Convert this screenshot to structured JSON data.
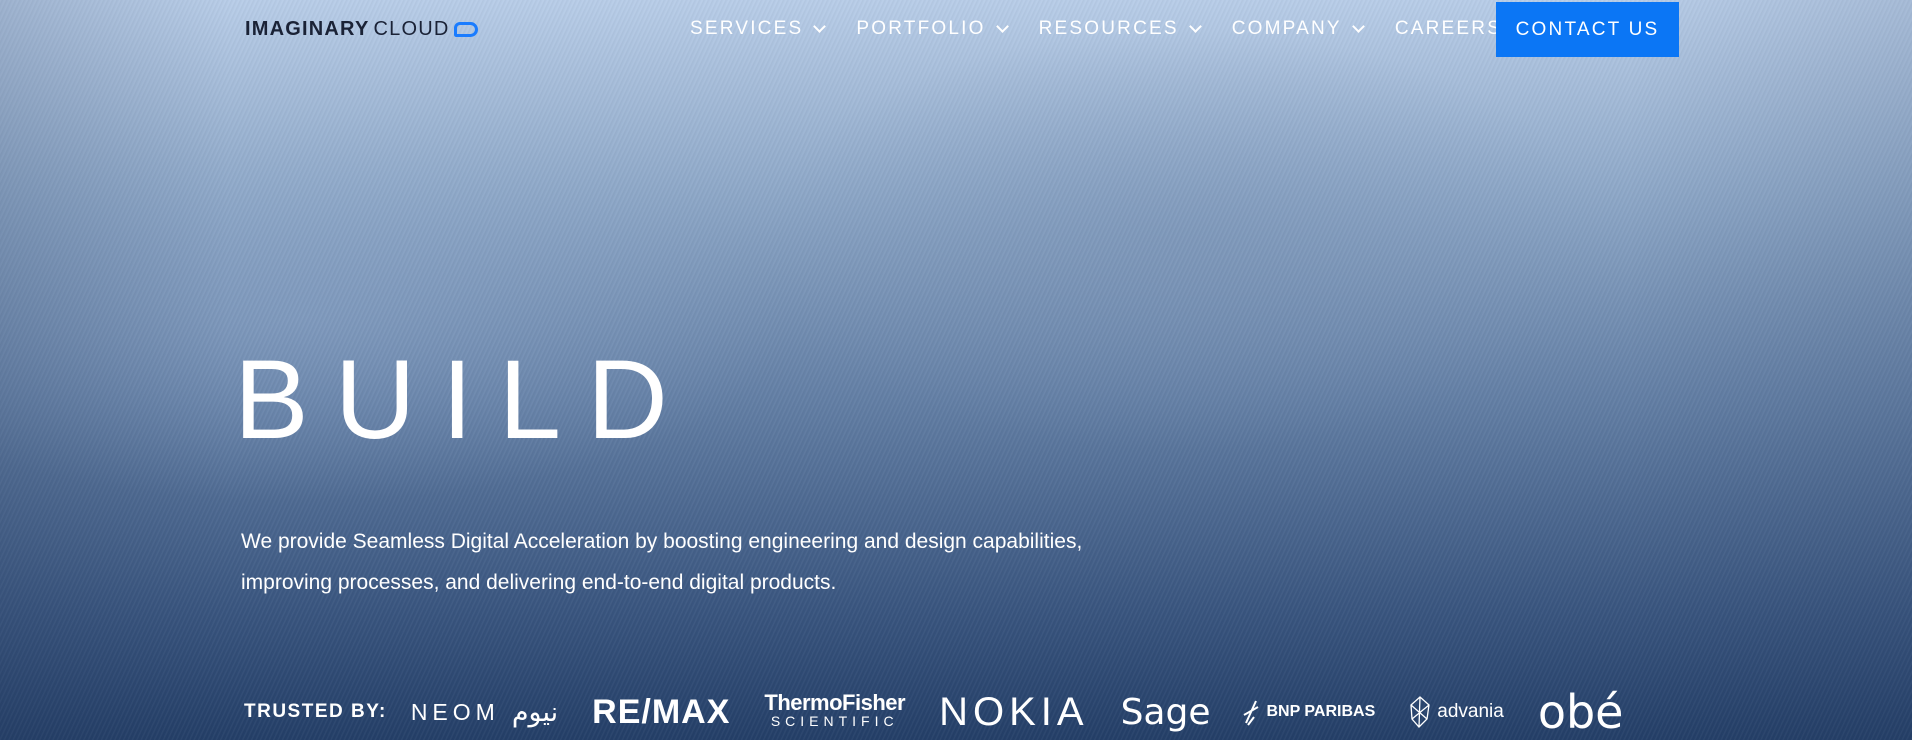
{
  "header": {
    "logo": {
      "bold": "IMAGINARY",
      "light": "CLOUD",
      "icon": "cloud-bubble-icon",
      "accent_color": "#1a7cff"
    },
    "nav": {
      "services": "SERVICES",
      "portfolio": "PORTFOLIO",
      "resources": "RESOURCES",
      "company": "COMPANY",
      "careers": "CAREERS"
    },
    "contact_label": "CONTACT US",
    "contact_color": "#0b76f5"
  },
  "hero": {
    "title": "BUILD",
    "subtitle_line1": "We provide Seamless Digital Acceleration by boosting engineering and design capabilities,",
    "subtitle_line2": "improving processes, and delivering end-to-end digital products."
  },
  "trusted": {
    "label": "TRUSTED BY:",
    "clients": {
      "neom": "NEOM",
      "neom_ar": "نيوم",
      "remax": "RE/MAX",
      "thermo_1": "ThermoFisher",
      "thermo_2": "SCIENTIFIC",
      "nokia": "NOKIA",
      "sage": "Sage",
      "bnp": "BNP PARIBAS",
      "advania": "advania",
      "obe": "obé"
    }
  }
}
